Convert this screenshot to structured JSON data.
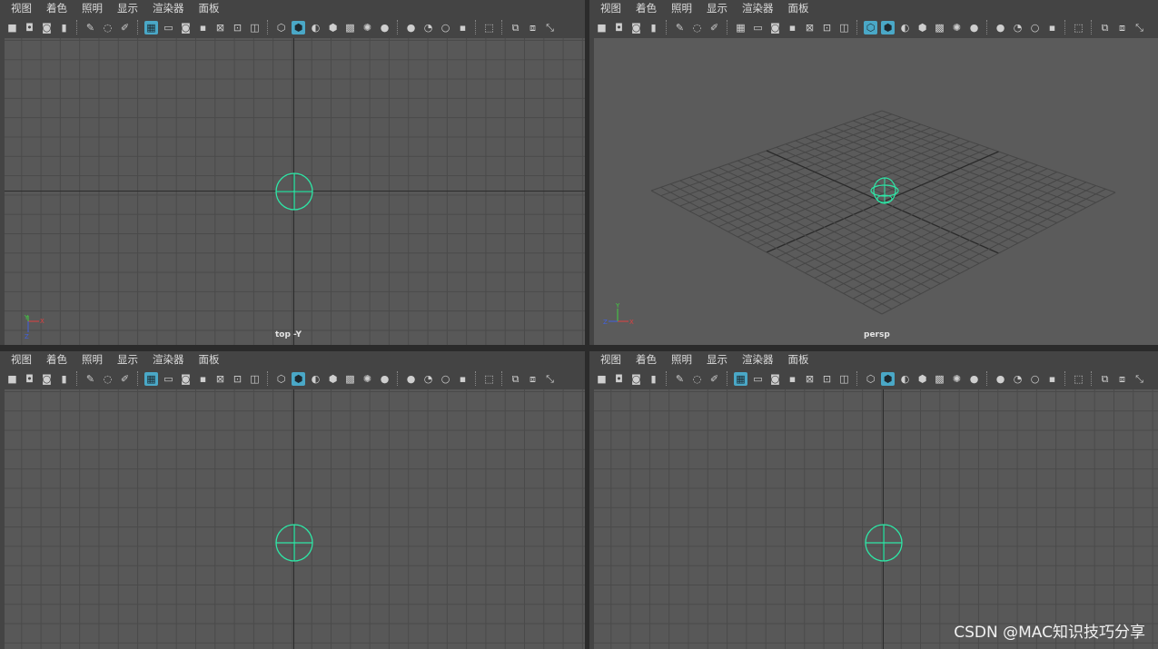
{
  "menu": [
    "视图",
    "着色",
    "照明",
    "显示",
    "渲染器",
    "面板"
  ],
  "toolbar_icons": [
    "camera-icon",
    "camera-attr-icon",
    "camera-lock-icon",
    "bookmark-icon",
    "sep",
    "pencil-icon",
    "lasso-icon",
    "brush-icon",
    "sep",
    "grid-icon",
    "film-gate-icon",
    "resolution-gate-icon",
    "safe-action-icon",
    "gate-mask-icon",
    "field-chart-icon",
    "safe-title-icon",
    "sep",
    "wireframe-icon",
    "smooth-shade-icon",
    "default-material-icon",
    "textured-icon",
    "xray-icon",
    "light-icon",
    "shadow-icon",
    "sep",
    "ambient-occlusion-icon",
    "motion-blur-icon",
    "antialias-icon",
    "depth-of-field-icon",
    "sep",
    "isolate-select-icon",
    "sep",
    "xray-joints-icon",
    "xray-active-icon",
    "camera-fit-icon"
  ],
  "panels": {
    "top_left": {
      "camera": "top -Y"
    },
    "top_right": {
      "camera": "persp"
    },
    "bottom_left": {
      "camera": ""
    },
    "bottom_right": {
      "camera": ""
    }
  },
  "accent_color": "#4aa8c7",
  "object_color": "#2ee6a6",
  "watermark": "CSDN @MAC知识技巧分享"
}
